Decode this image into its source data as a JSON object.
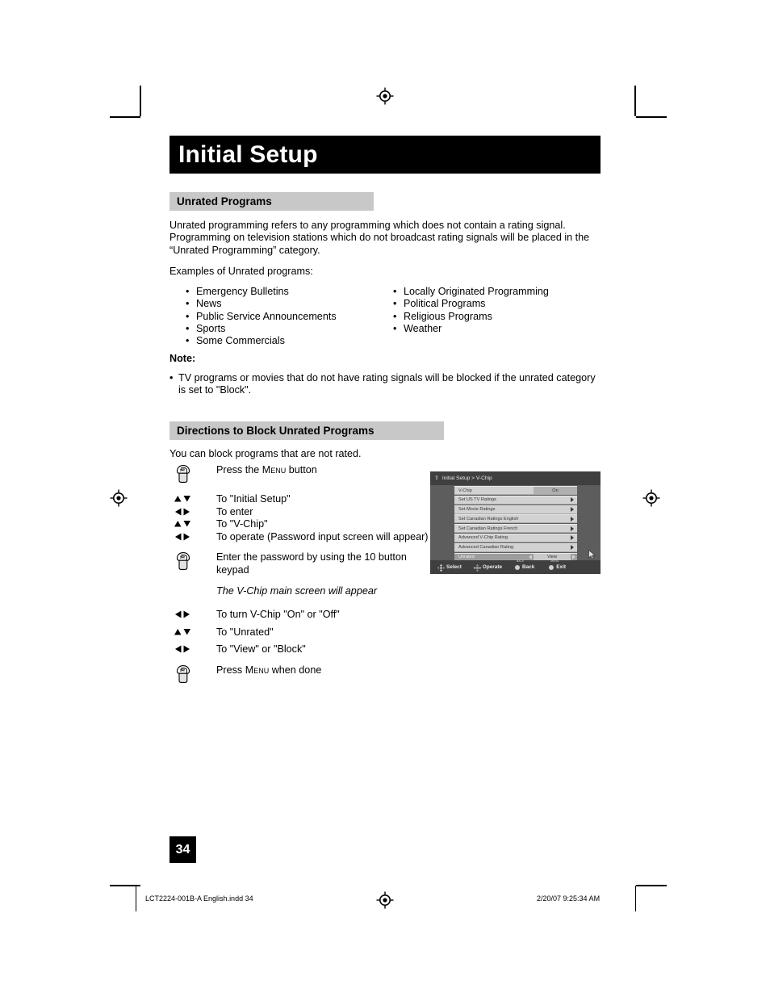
{
  "document": {
    "title": "Initial Setup",
    "page_number": "34",
    "footer_left": "LCT2224-001B-A English.indd   34",
    "footer_right": "2/20/07   9:25:34 AM"
  },
  "section_unrated": {
    "heading": "Unrated Programs",
    "intro": "Unrated programming refers to any programming which does not contain a rating signal. Programming on television stations which do not broadcast rating signals will be placed in the “Unrated Programming” category.",
    "examples_label": "Examples of Unrated programs:",
    "examples_left": [
      "Emergency Bulletins",
      "News",
      "Public Service Announcements",
      "Sports",
      "Some Commercials"
    ],
    "examples_right": [
      "Locally Originated Programming",
      "Political Programs",
      "Religious Programs",
      "Weather"
    ],
    "note_label": "Note:",
    "note_text": "TV programs or movies that do not have rating signals will be blocked if the unrated category is set to \"Block\"."
  },
  "section_directions": {
    "heading": "Directions to Block Unrated Programs",
    "intro": "You can block programs that are not rated.",
    "steps": [
      {
        "icon": "hand-press-button-icon",
        "text_pre": "Press the ",
        "text_sc": "Menu",
        "text_post": " button"
      },
      {
        "icon": "up-down-arrows-icon",
        "text": "To \"Initial Setup\""
      },
      {
        "icon": "left-right-arrows-icon",
        "text": "To enter"
      },
      {
        "icon": "up-down-arrows-icon",
        "text": "To \"V-Chip\""
      },
      {
        "icon": "left-right-arrows-icon",
        "text": "To operate (Password input screen will appear)"
      },
      {
        "icon": "hand-press-button-icon",
        "text": "Enter the password by using the 10 button keypad"
      },
      {
        "icon": "none",
        "text": "The V-Chip main screen will appear",
        "italic": true
      },
      {
        "icon": "left-right-arrows-icon",
        "text": "To turn V-Chip \"On\" or \"Off\""
      },
      {
        "icon": "up-down-arrows-icon",
        "text": "To \"Unrated\""
      },
      {
        "icon": "left-right-arrows-icon",
        "text": "To \"View\" or \"Block\""
      },
      {
        "icon": "hand-press-button-icon",
        "text_pre": "Press ",
        "text_sc": "Menu",
        "text_post": " when done"
      }
    ]
  },
  "tv_screen": {
    "header_breadcrumb": "Initial Setup > V-Chip",
    "rows": [
      {
        "label": "V-Chip",
        "value": "On",
        "type": "value"
      },
      {
        "label": "Set US TV Ratings",
        "type": "submenu"
      },
      {
        "label": "Set Movie Ratings",
        "type": "submenu"
      },
      {
        "label": "Set Canadian Ratings English",
        "type": "submenu"
      },
      {
        "label": "Set Canadian Ratings French",
        "type": "submenu"
      },
      {
        "label": "Advanced V-Chip Rating",
        "type": "submenu"
      },
      {
        "label": "Advanced Canadian Rating",
        "type": "submenu"
      },
      {
        "label": "Unrated",
        "value": "View",
        "type": "adjust",
        "selected": true
      }
    ],
    "footer_hints": [
      {
        "icon": "dpad-vertical-icon",
        "label": "Select",
        "tag": ""
      },
      {
        "icon": "dpad-horizontal-icon",
        "label": "Operate",
        "tag": ""
      },
      {
        "icon": "round-button-icon",
        "label": "Back",
        "tag": "BACK"
      },
      {
        "icon": "round-button-icon",
        "label": "Exit",
        "tag": "MENU"
      }
    ],
    "colors": {
      "background": "#5d5d5d",
      "bar": "#3f3f3f",
      "row": "#d2d2d2",
      "row_selected": "#9d9d9d",
      "value_box": "#b0b0b0"
    }
  }
}
